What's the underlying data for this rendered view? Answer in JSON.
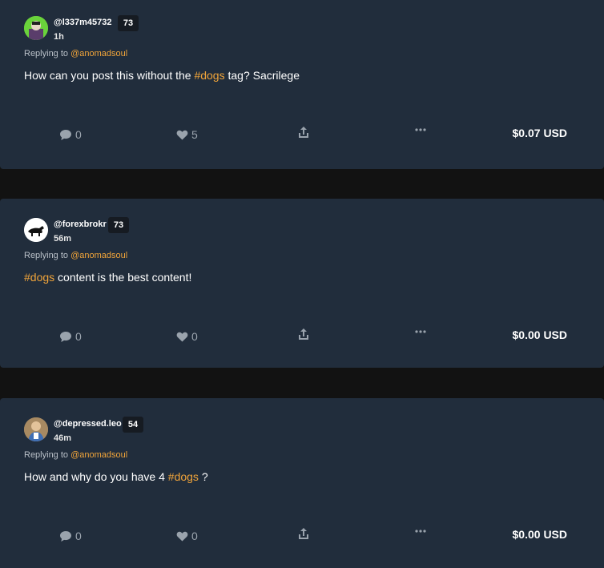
{
  "posts": [
    {
      "author": "@l337m45732",
      "reputation": "73",
      "time": "1h",
      "replying_prefix": "Replying to",
      "replying_to": "@anomadsoul",
      "body_before": "How can you post this without the ",
      "tag": "#dogs",
      "body_after": " tag? Sacrilege",
      "comments": "0",
      "likes": "5",
      "payout": "$0.07 USD",
      "avatar_color": "#6ad33b"
    },
    {
      "author": "@forexbrokr",
      "reputation": "73",
      "time": "56m",
      "replying_prefix": "Replying to",
      "replying_to": "@anomadsoul",
      "body_before": "",
      "tag": "#dogs",
      "body_after": " content is the best content!",
      "comments": "0",
      "likes": "0",
      "payout": "$0.00 USD",
      "avatar_color": "#ffffff"
    },
    {
      "author": "@depressed.leo",
      "reputation": "54",
      "time": "46m",
      "replying_prefix": "Replying to",
      "replying_to": "@anomadsoul",
      "body_before": "How and why do you have 4 ",
      "tag": "#dogs",
      "body_after": " ?",
      "comments": "0",
      "likes": "0",
      "payout": "$0.00 USD",
      "avatar_color": "#a88a62"
    }
  ],
  "colors": {
    "card_bg": "#212d3c",
    "page_bg": "#121212",
    "accent": "#f0a43a",
    "icon": "#9aa3ad"
  }
}
